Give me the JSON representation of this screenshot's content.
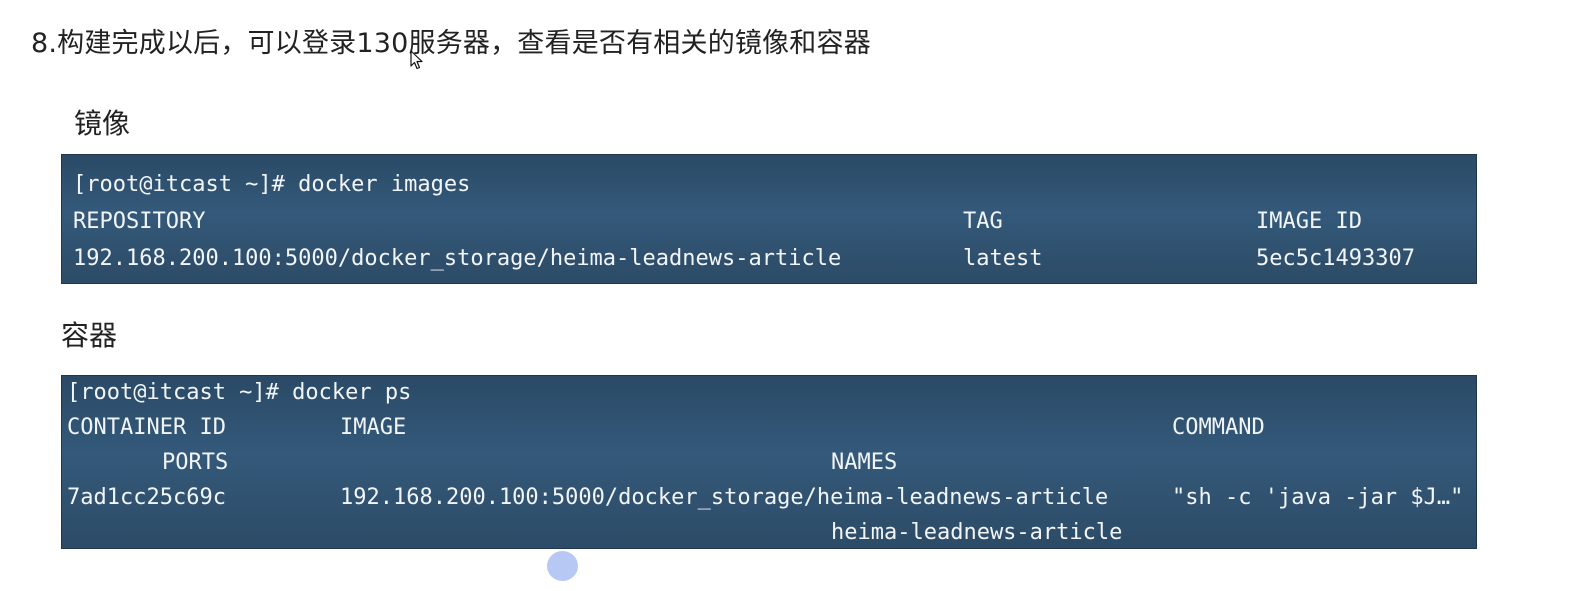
{
  "heading": "8.构建完成以后，可以登录130服务器，查看是否有相关的镜像和容器",
  "sections": {
    "images_label": "镜像",
    "containers_label": "容器"
  },
  "images_terminal": {
    "command": "[root@itcast ~]# docker images",
    "headers": {
      "repository": "REPOSITORY",
      "tag": "TAG",
      "image_id": "IMAGE ID"
    },
    "row": {
      "repository": "192.168.200.100:5000/docker_storage/heima-leadnews-article",
      "tag": "latest",
      "image_id": "5ec5c1493307"
    }
  },
  "ps_terminal": {
    "command": "[root@itcast ~]# docker ps",
    "headers": {
      "container_id": "CONTAINER ID",
      "image": "IMAGE",
      "command": "COMMAND",
      "ports": "PORTS",
      "names": "NAMES"
    },
    "row": {
      "container_id": "7ad1cc25c69c",
      "image": "192.168.200.100:5000/docker_storage/heima-leadnews-article",
      "command": "\"sh -c 'java -jar $J…\"",
      "names": "heima-leadnews-article"
    }
  },
  "icons": {
    "cursor": "mouse-cursor-icon",
    "pointer": "pointer-highlight-icon"
  },
  "colors": {
    "terminal_bg": "#34597a",
    "terminal_text": "#f2f5f8",
    "pointer_dot": "#b8c8f5"
  }
}
